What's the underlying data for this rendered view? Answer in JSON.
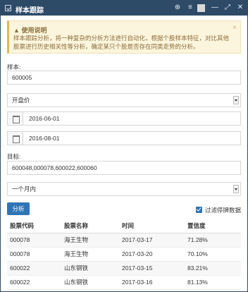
{
  "window": {
    "title": "样本跟踪",
    "icons": [
      "check-square-icon",
      "zoom-icon",
      "settings-icon",
      "color-square-icon",
      "minimize-icon",
      "maximize-icon",
      "close-icon"
    ]
  },
  "alert": {
    "title": "使用说明",
    "body": "样本跟踪分析，将一种复杂的分析方法进行自动化，根据个股样本特征，对比其他股票进行历史相关性等分析，确定某只个股是否存在同类走势的分析。",
    "close": "×",
    "warning_color": "#8a6d3b"
  },
  "form": {
    "sample_label": "样本:",
    "sample_value": "600005",
    "price_select": "开盘价",
    "start_date": "2016-06-01",
    "end_date": "2016-08-01",
    "target_label": "目标:",
    "target_value": "600048,000078,600022,600060",
    "period_select": "一个月内"
  },
  "actions": {
    "analyze_label": "分析",
    "filter_label": "过滤停牌数据",
    "filter_checked": true,
    "accent": "#2f75b5"
  },
  "table": {
    "headers": [
      "股票代码",
      "股票名称",
      "时间",
      "置信度"
    ],
    "rows": [
      [
        "000078",
        "海王生物",
        "2017-03-17",
        "71.28%"
      ],
      [
        "000078",
        "海王生物",
        "2017-03-20",
        "70.10%"
      ],
      [
        "600022",
        "山东钢铁",
        "2017-03-15",
        "83.21%"
      ],
      [
        "600022",
        "山东钢铁",
        "2017-03-16",
        "81.13%"
      ]
    ]
  }
}
